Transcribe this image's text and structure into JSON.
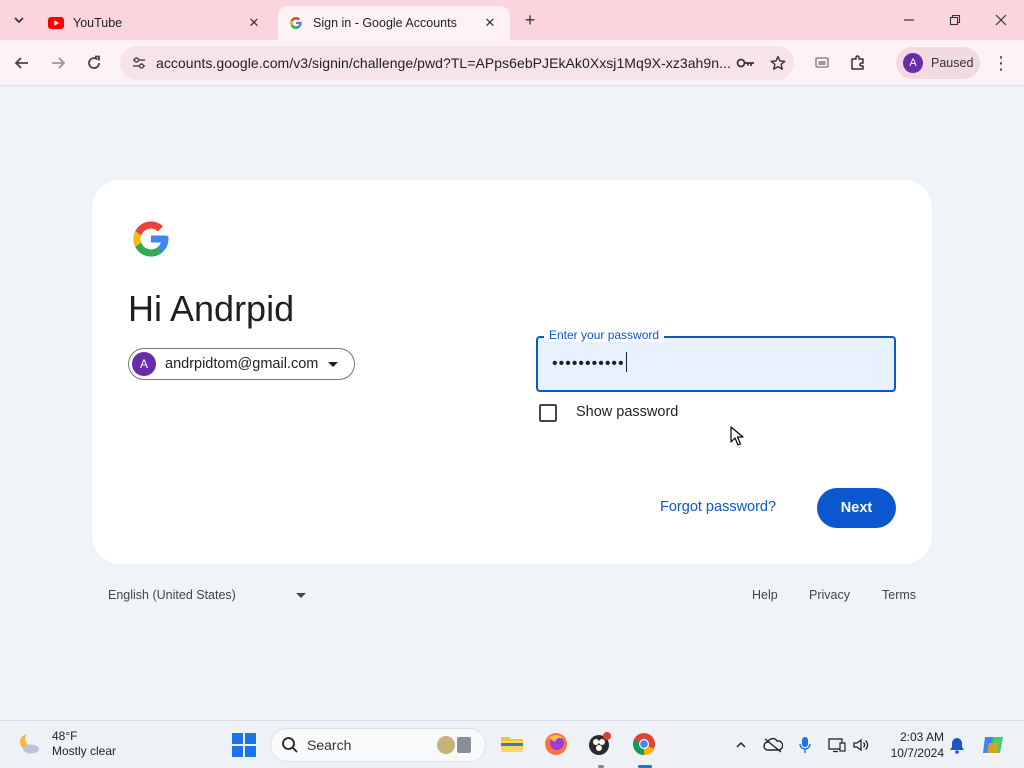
{
  "browser": {
    "tabs": [
      {
        "title": "YouTube",
        "favicon": "youtube-icon",
        "active": false
      },
      {
        "title": "Sign in - Google Accounts",
        "favicon": "google-g-icon",
        "active": true
      }
    ],
    "url": "accounts.google.com/v3/signin/challenge/pwd?TL=APps6ebPJEkAk0Xxsj1Mq9X-xz3ah9n...",
    "profile_initial": "A",
    "profile_status": "Paused"
  },
  "signin": {
    "greeting": "Hi Andrpid",
    "account_initial": "A",
    "account_email": "andrpidtom@gmail.com",
    "password_label": "Enter your password",
    "password_value": "•••••••••••",
    "show_password_label": "Show password",
    "show_password_checked": false,
    "forgot_link": "Forgot password?",
    "next_button": "Next"
  },
  "footer": {
    "language": "English (United States)",
    "links": [
      "Help",
      "Privacy",
      "Terms"
    ]
  },
  "taskbar": {
    "weather_temp": "48°F",
    "weather_desc": "Mostly clear",
    "search_label": "Search",
    "time": "2:03 AM",
    "date": "10/7/2024"
  },
  "colors": {
    "accent": "#0b57d0",
    "page_bg": "#f0f4f9",
    "tabbar_bg": "#fbd5dd",
    "avatar": "#6a2ba8"
  }
}
